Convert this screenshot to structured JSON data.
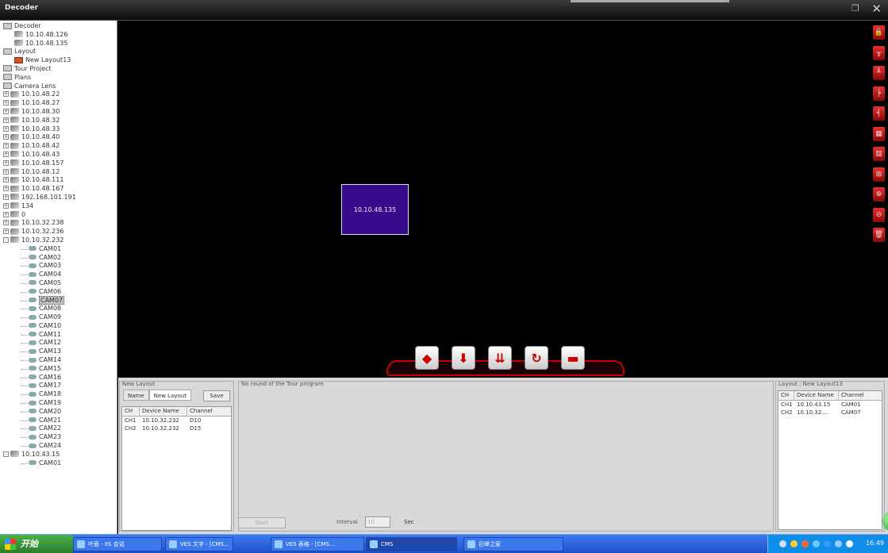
{
  "window": {
    "title": "Decoder"
  },
  "tree": [
    {
      "level": 0,
      "type": "folder",
      "label": "Decoder",
      "exp": ""
    },
    {
      "level": 1,
      "type": "dev",
      "label": "10.10.48.126",
      "exp": ""
    },
    {
      "level": 1,
      "type": "dev",
      "label": "10.10.48.135",
      "exp": ""
    },
    {
      "level": 0,
      "type": "folder",
      "label": "Layout",
      "exp": ""
    },
    {
      "level": 1,
      "type": "layout",
      "label": "New Layout13",
      "exp": ""
    },
    {
      "level": 0,
      "type": "folder",
      "label": "Tour Project",
      "exp": ""
    },
    {
      "level": 0,
      "type": "folder",
      "label": "Plans",
      "exp": ""
    },
    {
      "level": 0,
      "type": "folder",
      "label": "Camera Lens",
      "exp": ""
    },
    {
      "level": 0,
      "type": "dev",
      "label": "10.10.48.22",
      "exp": "+"
    },
    {
      "level": 0,
      "type": "dev",
      "label": "10.10.48.27",
      "exp": "+"
    },
    {
      "level": 0,
      "type": "dev",
      "label": "10.10.48.30",
      "exp": "+"
    },
    {
      "level": 0,
      "type": "dev",
      "label": "10.10.48.32",
      "exp": "+"
    },
    {
      "level": 0,
      "type": "dev",
      "label": "10.10.48.33",
      "exp": "+"
    },
    {
      "level": 0,
      "type": "dev",
      "label": "10.10.48.40",
      "exp": "+"
    },
    {
      "level": 0,
      "type": "dev",
      "label": "10.10.48.42",
      "exp": "+"
    },
    {
      "level": 0,
      "type": "dev",
      "label": "10.10.48.43",
      "exp": "+"
    },
    {
      "level": 0,
      "type": "dev",
      "label": "10.10.48.157",
      "exp": "+"
    },
    {
      "level": 0,
      "type": "dev",
      "label": "10.10.48.12",
      "exp": "+"
    },
    {
      "level": 0,
      "type": "dev",
      "label": "10.10.48.111",
      "exp": "+"
    },
    {
      "level": 0,
      "type": "dev",
      "label": "10.10.48.167",
      "exp": "+"
    },
    {
      "level": 0,
      "type": "dev",
      "label": "192.168.101.191",
      "exp": "+"
    },
    {
      "level": 0,
      "type": "dev",
      "label": "134",
      "exp": "+"
    },
    {
      "level": 0,
      "type": "dev",
      "label": "0",
      "exp": "+"
    },
    {
      "level": 0,
      "type": "dev",
      "label": "10.10.32.238",
      "exp": "+"
    },
    {
      "level": 0,
      "type": "dev",
      "label": "10.10.32.236",
      "exp": "+"
    },
    {
      "level": 0,
      "type": "dev",
      "label": "10.10.32.232",
      "exp": "-"
    },
    {
      "level": 2,
      "type": "cam",
      "label": "CAM01",
      "exp": ""
    },
    {
      "level": 2,
      "type": "cam",
      "label": "CAM02",
      "exp": ""
    },
    {
      "level": 2,
      "type": "cam",
      "label": "CAM03",
      "exp": ""
    },
    {
      "level": 2,
      "type": "cam",
      "label": "CAM04",
      "exp": ""
    },
    {
      "level": 2,
      "type": "cam",
      "label": "CAM05",
      "exp": ""
    },
    {
      "level": 2,
      "type": "cam",
      "label": "CAM06",
      "exp": ""
    },
    {
      "level": 2,
      "type": "cam",
      "label": "CAM07",
      "exp": "",
      "selected": true
    },
    {
      "level": 2,
      "type": "cam",
      "label": "CAM08",
      "exp": ""
    },
    {
      "level": 2,
      "type": "cam",
      "label": "CAM09",
      "exp": ""
    },
    {
      "level": 2,
      "type": "cam",
      "label": "CAM10",
      "exp": ""
    },
    {
      "level": 2,
      "type": "cam",
      "label": "CAM11",
      "exp": ""
    },
    {
      "level": 2,
      "type": "cam",
      "label": "CAM12",
      "exp": ""
    },
    {
      "level": 2,
      "type": "cam",
      "label": "CAM13",
      "exp": ""
    },
    {
      "level": 2,
      "type": "cam",
      "label": "CAM14",
      "exp": ""
    },
    {
      "level": 2,
      "type": "cam",
      "label": "CAM15",
      "exp": ""
    },
    {
      "level": 2,
      "type": "cam",
      "label": "CAM16",
      "exp": ""
    },
    {
      "level": 2,
      "type": "cam",
      "label": "CAM17",
      "exp": ""
    },
    {
      "level": 2,
      "type": "cam",
      "label": "CAM18",
      "exp": ""
    },
    {
      "level": 2,
      "type": "cam",
      "label": "CAM19",
      "exp": ""
    },
    {
      "level": 2,
      "type": "cam",
      "label": "CAM20",
      "exp": ""
    },
    {
      "level": 2,
      "type": "cam",
      "label": "CAM21",
      "exp": ""
    },
    {
      "level": 2,
      "type": "cam",
      "label": "CAM22",
      "exp": ""
    },
    {
      "level": 2,
      "type": "cam",
      "label": "CAM23",
      "exp": ""
    },
    {
      "level": 2,
      "type": "cam",
      "label": "CAM24",
      "exp": ""
    },
    {
      "level": 0,
      "type": "dev",
      "label": "10.10.43.15",
      "exp": "-"
    },
    {
      "level": 2,
      "type": "cam",
      "label": "CAM01",
      "exp": ""
    }
  ],
  "video": {
    "screen_label": "10.10.48.135",
    "screen_color": "#3a0a8c"
  },
  "right_toolbar": [
    "lock-icon",
    "layout-top-icon",
    "layout-bottom-icon",
    "layout-left-icon",
    "layout-right-icon",
    "layout-grid-icon",
    "layout-columns-icon",
    "layout-split-icon",
    "zoom-in-icon",
    "zoom-out-icon",
    "delete-icon"
  ],
  "dock_buttons": [
    "eraser-icon",
    "download-icon",
    "download-all-icon",
    "refresh-icon",
    "clear-icon"
  ],
  "new_layout": {
    "title": "New Layout",
    "name_tab": "Name",
    "name_value": "New Layout",
    "save_label": "Save",
    "headers": [
      "CH",
      "Device Name",
      "Channel"
    ],
    "rows": [
      [
        "CH1",
        "10.10.32.232",
        "D10"
      ],
      [
        "CH2",
        "10.10.32.232",
        "D15"
      ]
    ]
  },
  "tour": {
    "title": "No round of the Tour program",
    "start_label": "Start",
    "interval_label": "Interval",
    "interval_value": "10",
    "sec_label": "Sec"
  },
  "layout_detail": {
    "title": "Layout : New Layout13",
    "headers": [
      "CH",
      "Device Name",
      "Channel"
    ],
    "rows": [
      [
        "CH1",
        "10.10.43.15",
        "CAM01"
      ],
      [
        "CH2",
        "10.10.32....",
        "CAM07"
      ]
    ]
  },
  "taskbar": {
    "start_label": "开始",
    "tasks": [
      {
        "label": "叶面 - IIS 会话",
        "active": false
      },
      {
        "label": "VES 文字 - [CMS...",
        "active": false
      },
      {
        "label": "VES 表格 - [CMS...",
        "active": false
      },
      {
        "label": "CMS",
        "active": true
      },
      {
        "label": "巨峰之家",
        "active": false
      }
    ],
    "clock": "16:49"
  }
}
